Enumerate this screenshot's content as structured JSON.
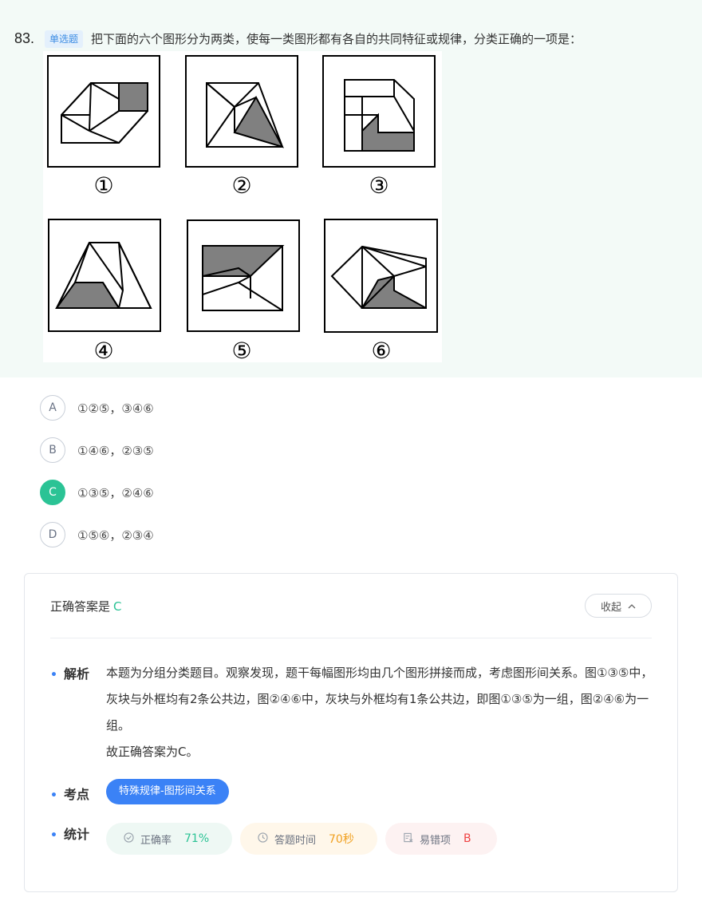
{
  "question": {
    "number": "83.",
    "type_badge": "单选题",
    "text": "把下面的六个图形分为两类，使每一类图形都有各自的共同特征或规律，分类正确的一项是：",
    "figure_labels": [
      "①",
      "②",
      "③",
      "④",
      "⑤",
      "⑥"
    ]
  },
  "options": [
    {
      "letter": "A",
      "text": "①②⑤，③④⑥",
      "correct": false
    },
    {
      "letter": "B",
      "text": "①④⑥，②③⑤",
      "correct": false
    },
    {
      "letter": "C",
      "text": "①③⑤，②④⑥",
      "correct": true
    },
    {
      "letter": "D",
      "text": "①⑤⑥，②③④",
      "correct": false
    }
  ],
  "analysis": {
    "answer_prefix": "正确答案是",
    "answer_letter": "C",
    "collapse_label": "收起",
    "collapse_icon": "chevron-up-icon",
    "explain_label": "解析",
    "explain_text": "本题为分组分类题目。观察发现，题干每幅图形均由几个图形拼接而成，考虑图形间关系。图①③⑤中，灰块与外框均有2条公共边，图②④⑥中，灰块与外框均有1条公共边，即图①③⑤为一组，图②④⑥为一组。",
    "conclusion": "故正确答案为C。",
    "knowledge_label": "考点",
    "knowledge_tag": "特殊规律-图形间关系",
    "stats_label": "统计",
    "stats": {
      "rate_label": "正确率",
      "rate_value": "71%",
      "time_label": "答题时间",
      "time_value": "70秒",
      "error_label": "易错项",
      "error_value": "B"
    }
  },
  "colors": {
    "question_bg": "#f3faf7",
    "correct": "#2bc395",
    "accent_blue": "#3b82f6",
    "gray_fill": "#808080"
  }
}
